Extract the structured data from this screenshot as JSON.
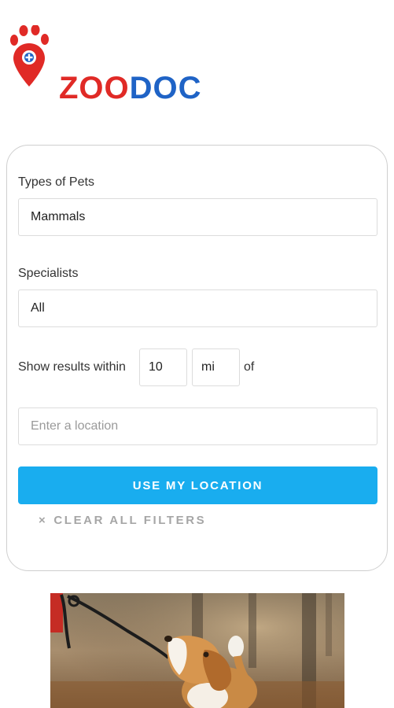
{
  "logo": {
    "part1": "ZOO",
    "part2": "DOC"
  },
  "filters": {
    "pet_type_label": "Types of Pets",
    "pet_type_value": "Mammals",
    "specialist_label": "Specialists",
    "specialist_value": "All",
    "within_label": "Show results within",
    "distance_value": "10",
    "unit_value": "mi",
    "of_label": "of",
    "location_placeholder": "Enter a location",
    "use_location_label": "USE MY LOCATION",
    "clear_label": "CLEAR ALL FILTERS",
    "clear_icon": "×"
  },
  "photo": {
    "subject": "beagle-on-leash"
  },
  "colors": {
    "brand_red": "#e02a26",
    "brand_blue": "#1f63c6",
    "accent": "#19adef"
  }
}
